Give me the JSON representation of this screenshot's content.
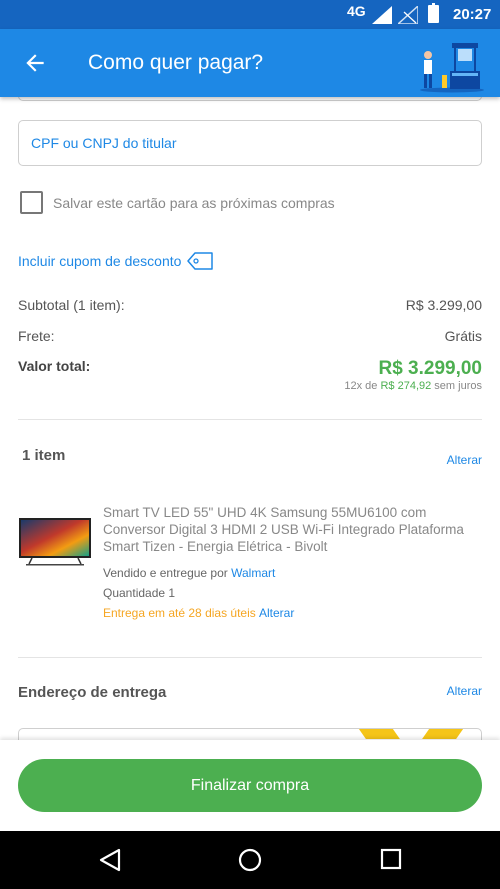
{
  "status": {
    "network": "4G",
    "time": "20:27"
  },
  "header": {
    "title": "Como quer pagar?"
  },
  "form": {
    "cpf_placeholder": "CPF ou CNPJ do titular",
    "save_card_label": "Salvar este cartão para as próximas compras",
    "save_card_checked": false,
    "coupon_label": "Incluir cupom de desconto"
  },
  "summary": {
    "subtotal_label": "Subtotal (1 item):",
    "subtotal_value": "R$ 3.299,00",
    "shipping_label": "Frete:",
    "shipping_value": "Grátis",
    "total_label": "Valor total:",
    "total_value": "R$ 3.299,00",
    "installments_prefix": "12x de ",
    "installments_value": "R$ 274,92",
    "installments_suffix": " sem juros"
  },
  "items": {
    "title": "1 item",
    "alter_label": "Alterar",
    "product": {
      "name": "Smart TV LED 55\" UHD 4K Samsung 55MU6100 com Conversor Digital 3 HDMI 2 USB Wi-Fi Integrado Plataforma Smart Tizen - Energia Elétrica - Bivolt",
      "seller_prefix": "Vendido e entregue por ",
      "seller": "Walmart",
      "quantity": "Quantidade 1",
      "delivery": "Entrega em até 28 dias úteis",
      "delivery_alter": "Alterar"
    }
  },
  "address": {
    "title": "Endereço de entrega",
    "alter_label": "Alterar"
  },
  "footer": {
    "finalize_label": "Finalizar compra"
  },
  "colors": {
    "primary": "#1e88e5",
    "status_bar": "#1565c0",
    "success": "#4caf50",
    "warning": "#f5a623"
  }
}
